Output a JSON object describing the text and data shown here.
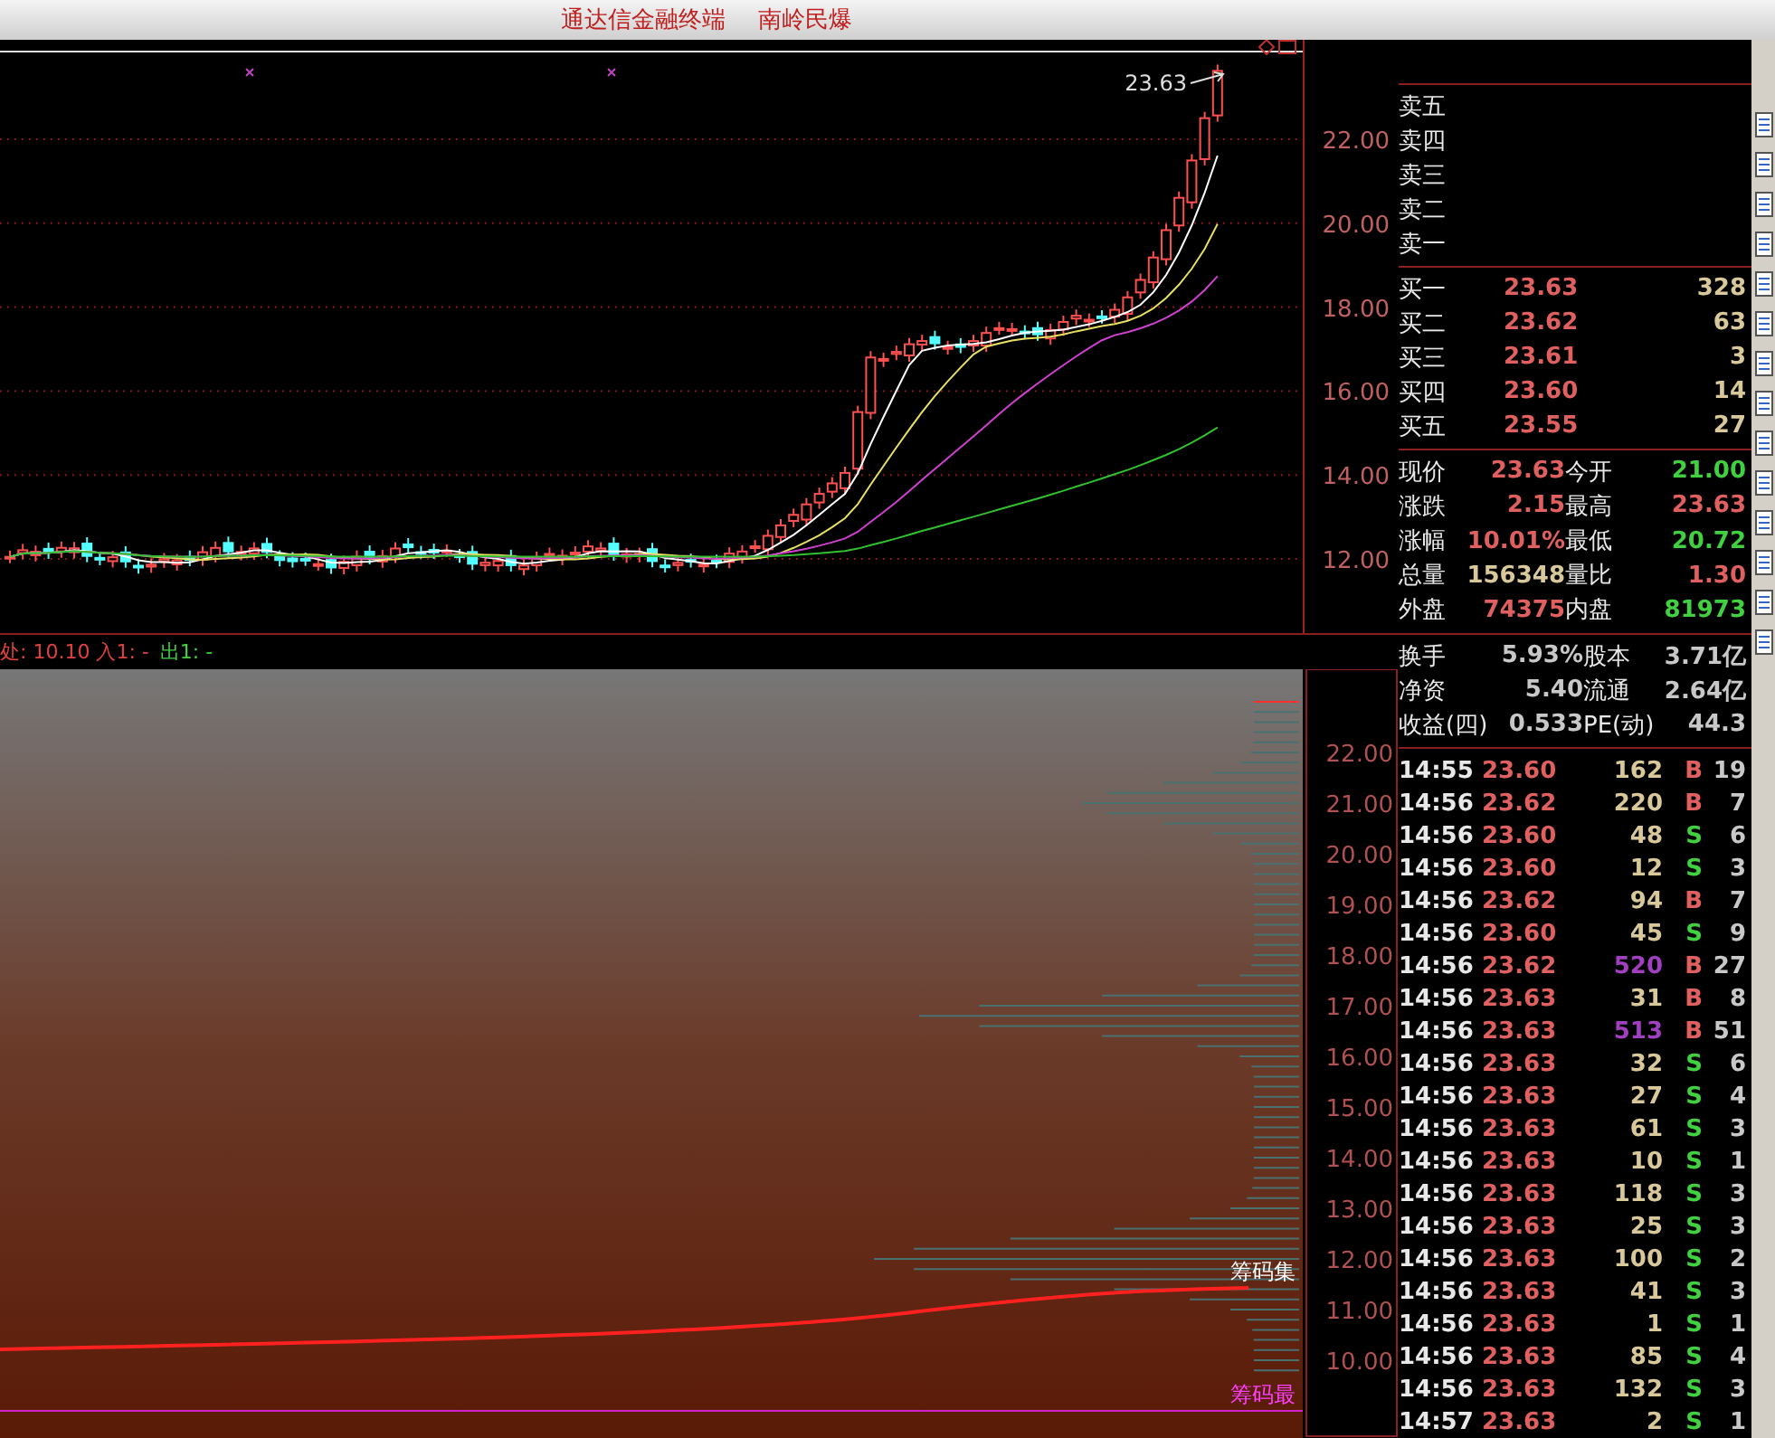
{
  "title_bar": {
    "app": "通达信金融终端",
    "stock": "南岭民爆"
  },
  "price_chart": {
    "last_price_label": "23.63",
    "y_axis": [
      "22.00",
      "20.00",
      "18.00",
      "16.00",
      "14.00",
      "12.00"
    ]
  },
  "indicator_legend": [
    {
      "text": "处: 10.10 入1: -",
      "color": "#e04040"
    },
    {
      "text": "出1: -",
      "color": "#40d040"
    }
  ],
  "chip_chart": {
    "y_axis": [
      "22.00",
      "21.00",
      "20.00",
      "19.00",
      "18.00",
      "17.00",
      "16.00",
      "15.00",
      "14.00",
      "13.00",
      "12.00",
      "11.00",
      "10.00"
    ],
    "labels": [
      {
        "text": "筹码集",
        "color": "#ffffff"
      },
      {
        "text": "筹码最",
        "color": "#ff40ff"
      }
    ]
  },
  "order_book": {
    "asks": [
      {
        "label": "卖五"
      },
      {
        "label": "卖四"
      },
      {
        "label": "卖三"
      },
      {
        "label": "卖二"
      },
      {
        "label": "卖一"
      }
    ],
    "bids": [
      {
        "label": "买一",
        "price": "23.63",
        "volume": "328"
      },
      {
        "label": "买二",
        "price": "23.62",
        "volume": "63"
      },
      {
        "label": "买三",
        "price": "23.61",
        "volume": "3"
      },
      {
        "label": "买四",
        "price": "23.60",
        "volume": "14"
      },
      {
        "label": "买五",
        "price": "23.55",
        "volume": "27"
      }
    ]
  },
  "stats": [
    {
      "cells": [
        {
          "label": "现价",
          "value": "23.63",
          "color": "#e06060"
        },
        {
          "label": "今开",
          "value": "21.00",
          "color": "#40d040"
        }
      ]
    },
    {
      "cells": [
        {
          "label": "涨跌",
          "value": "2.15",
          "color": "#e06060"
        },
        {
          "label": "最高",
          "value": "23.63",
          "color": "#e06060"
        }
      ]
    },
    {
      "cells": [
        {
          "label": "涨幅",
          "value": "10.01%",
          "color": "#e06060"
        },
        {
          "label": "最低",
          "value": "20.72",
          "color": "#40d040"
        }
      ]
    },
    {
      "cells": [
        {
          "label": "总量",
          "value": "156348",
          "color": "#d8c89a"
        },
        {
          "label": "量比",
          "value": "1.30",
          "color": "#e06060"
        }
      ]
    },
    {
      "cells": [
        {
          "label": "外盘",
          "value": "74375",
          "color": "#e06060"
        },
        {
          "label": "内盘",
          "value": "81973",
          "color": "#40d040"
        }
      ]
    }
  ],
  "stats2": [
    {
      "label": "换手",
      "value": "5.93%",
      "label2": "股本",
      "value2": "3.71亿"
    },
    {
      "label": "净资",
      "value": "5.40",
      "label2": "流通",
      "value2": "2.64亿"
    },
    {
      "label": "收益(四)",
      "value": "0.533",
      "label2": "PE(动)",
      "value2": "44.3"
    }
  ],
  "trades": [
    {
      "time": "14:55",
      "price": "23.60",
      "volume": "162",
      "large": false,
      "side": "B",
      "count": "19"
    },
    {
      "time": "14:56",
      "price": "23.62",
      "volume": "220",
      "large": false,
      "side": "B",
      "count": "7"
    },
    {
      "time": "14:56",
      "price": "23.60",
      "volume": "48",
      "large": false,
      "side": "S",
      "count": "6"
    },
    {
      "time": "14:56",
      "price": "23.60",
      "volume": "12",
      "large": false,
      "side": "S",
      "count": "3"
    },
    {
      "time": "14:56",
      "price": "23.62",
      "volume": "94",
      "large": false,
      "side": "B",
      "count": "7"
    },
    {
      "time": "14:56",
      "price": "23.60",
      "volume": "45",
      "large": false,
      "side": "S",
      "count": "9"
    },
    {
      "time": "14:56",
      "price": "23.62",
      "volume": "520",
      "large": true,
      "side": "B",
      "count": "27"
    },
    {
      "time": "14:56",
      "price": "23.63",
      "volume": "31",
      "large": false,
      "side": "B",
      "count": "8"
    },
    {
      "time": "14:56",
      "price": "23.63",
      "volume": "513",
      "large": true,
      "side": "B",
      "count": "51"
    },
    {
      "time": "14:56",
      "price": "23.63",
      "volume": "32",
      "large": false,
      "side": "S",
      "count": "6"
    },
    {
      "time": "14:56",
      "price": "23.63",
      "volume": "27",
      "large": false,
      "side": "S",
      "count": "4"
    },
    {
      "time": "14:56",
      "price": "23.63",
      "volume": "61",
      "large": false,
      "side": "S",
      "count": "3"
    },
    {
      "time": "14:56",
      "price": "23.63",
      "volume": "10",
      "large": false,
      "side": "S",
      "count": "1"
    },
    {
      "time": "14:56",
      "price": "23.63",
      "volume": "118",
      "large": false,
      "side": "S",
      "count": "3"
    },
    {
      "time": "14:56",
      "price": "23.63",
      "volume": "25",
      "large": false,
      "side": "S",
      "count": "3"
    },
    {
      "time": "14:56",
      "price": "23.63",
      "volume": "100",
      "large": false,
      "side": "S",
      "count": "2"
    },
    {
      "time": "14:56",
      "price": "23.63",
      "volume": "41",
      "large": false,
      "side": "S",
      "count": "3"
    },
    {
      "time": "14:56",
      "price": "23.63",
      "volume": "1",
      "large": false,
      "side": "S",
      "count": "1"
    },
    {
      "time": "14:56",
      "price": "23.63",
      "volume": "85",
      "large": false,
      "side": "S",
      "count": "4"
    },
    {
      "time": "14:56",
      "price": "23.63",
      "volume": "132",
      "large": false,
      "side": "S",
      "count": "3"
    },
    {
      "time": "14:57",
      "price": "23.63",
      "volume": "2",
      "large": false,
      "side": "S",
      "count": "1"
    }
  ]
}
